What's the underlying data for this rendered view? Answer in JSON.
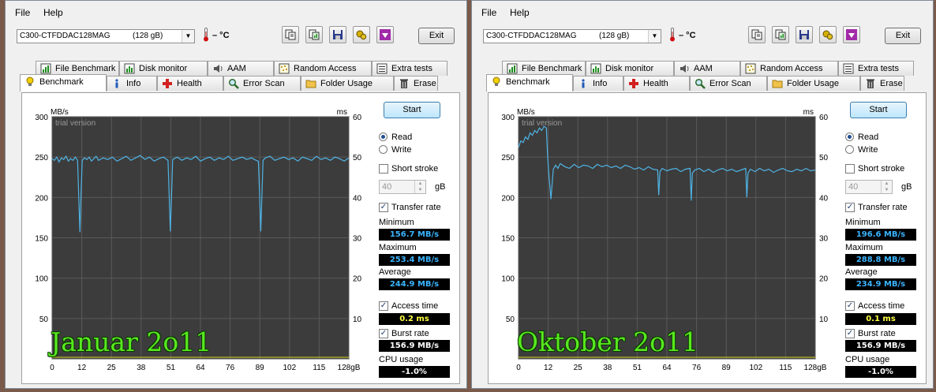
{
  "colors": {
    "accent": "#3399ff",
    "series": "#4fb4e6",
    "plot_bg": "#3c3c3c",
    "grid": "#5a5a5a",
    "overlay_text": "#58e820",
    "value_blue": "#3ab4ff",
    "value_yellow": "#ffff40"
  },
  "windows": [
    {
      "menu": {
        "file": "File",
        "help": "Help"
      },
      "drive": {
        "name": "C300-CTFDDAC128MAG",
        "size": "(128 gB)"
      },
      "temperature": "– °C",
      "toolbar_icons": [
        "copy-text-icon",
        "copy-screenshot-icon",
        "save-icon",
        "options-icon",
        "download-icon"
      ],
      "exit_label": "Exit",
      "tabs_top": [
        "File Benchmark",
        "Disk monitor",
        "AAM",
        "Random Access",
        "Extra tests"
      ],
      "tabs_bottom": [
        "Benchmark",
        "Info",
        "Health",
        "Error Scan",
        "Folder Usage",
        "Erase"
      ],
      "active_tab": "Benchmark",
      "start_label": "Start",
      "mode": {
        "read": "Read",
        "write": "Write",
        "selected": "read"
      },
      "short_stroke": {
        "label": "Short stroke",
        "value": "40",
        "unit": "gB",
        "checked": false
      },
      "transfer_rate": {
        "label": "Transfer rate",
        "checked": true
      },
      "minimum": {
        "label": "Minimum",
        "value": "156.7 MB/s"
      },
      "maximum": {
        "label": "Maximum",
        "value": "253.4 MB/s"
      },
      "average": {
        "label": "Average",
        "value": "244.9 MB/s"
      },
      "access_time": {
        "label": "Access time",
        "value": "0.2 ms",
        "checked": true
      },
      "burst_rate": {
        "label": "Burst rate",
        "value": "156.9 MB/s",
        "checked": true
      },
      "cpu_usage": {
        "label": "CPU usage",
        "value": "-1.0%"
      },
      "overlay_label": "Januar 2o11",
      "chart_data": {
        "type": "line",
        "watermark": "trial version",
        "y_left_label": "MB/s",
        "y_right_label": "ms",
        "y_left_range": [
          0,
          300
        ],
        "y_right_range": [
          0,
          60
        ],
        "y_left_ticks": [
          "300",
          "250",
          "200",
          "150",
          "100",
          "50"
        ],
        "y_right_ticks": [
          "60",
          "50",
          "40",
          "30",
          "20",
          "10"
        ],
        "x_range": [
          0,
          128
        ],
        "x_ticks": [
          "0",
          "12",
          "25",
          "38",
          "51",
          "64",
          "76",
          "89",
          "102",
          "115",
          "128gB"
        ],
        "grid": true,
        "series": [
          {
            "x": [
              0,
              1,
              2,
              3,
              4,
              5,
              6,
              7,
              8,
              9,
              10,
              11,
              11.5,
              12,
              12.5,
              13,
              14,
              15,
              16,
              17,
              18,
              19,
              20,
              22,
              24,
              26,
              28,
              30,
              32,
              34,
              36,
              38,
              40,
              42,
              44,
              46,
              48,
              50,
              50.5,
              51,
              51.5,
              52,
              54,
              56,
              58,
              60,
              62,
              64,
              66,
              68,
              70,
              72,
              74,
              76,
              78,
              80,
              82,
              84,
              86,
              88,
              89,
              89.5,
              90,
              90.5,
              91,
              92,
              94,
              96,
              98,
              100,
              102,
              104,
              106,
              108,
              110,
              112,
              114,
              116,
              118,
              120,
              122,
              124,
              126,
              128
            ],
            "y": [
              248,
              246,
              250,
              244,
              249,
              247,
              251,
              245,
              248,
              246,
              250,
              246,
              200,
              157,
              205,
              246,
              249,
              247,
              250,
              245,
              248,
              251,
              246,
              249,
              247,
              250,
              245,
              248,
              251,
              246,
              249,
              252,
              247,
              250,
              245,
              248,
              250,
              246,
              205,
              158,
              200,
              247,
              250,
              246,
              249,
              247,
              251,
              245,
              248,
              250,
              246,
              249,
              247,
              251,
              246,
              248,
              250,
              247,
              249,
              246,
              245,
              205,
              158,
              200,
              246,
              249,
              251,
              246,
              248,
              250,
              247,
              249,
              245,
              250,
              248,
              246,
              251,
              247,
              249,
              246,
              250,
              248,
              245,
              249
            ]
          }
        ]
      }
    },
    {
      "menu": {
        "file": "File",
        "help": "Help"
      },
      "drive": {
        "name": "C300-CTFDDAC128MAG",
        "size": "(128 gB)"
      },
      "temperature": "– °C",
      "toolbar_icons": [
        "copy-text-icon",
        "copy-screenshot-icon",
        "save-icon",
        "options-icon",
        "download-icon"
      ],
      "exit_label": "Exit",
      "tabs_top": [
        "File Benchmark",
        "Disk monitor",
        "AAM",
        "Random Access",
        "Extra tests"
      ],
      "tabs_bottom": [
        "Benchmark",
        "Info",
        "Health",
        "Error Scan",
        "Folder Usage",
        "Erase"
      ],
      "active_tab": "Benchmark",
      "start_label": "Start",
      "mode": {
        "read": "Read",
        "write": "Write",
        "selected": "read"
      },
      "short_stroke": {
        "label": "Short stroke",
        "value": "40",
        "unit": "gB",
        "checked": false
      },
      "transfer_rate": {
        "label": "Transfer rate",
        "checked": true
      },
      "minimum": {
        "label": "Minimum",
        "value": "196.6 MB/s"
      },
      "maximum": {
        "label": "Maximum",
        "value": "288.8 MB/s"
      },
      "average": {
        "label": "Average",
        "value": "234.9 MB/s"
      },
      "access_time": {
        "label": "Access time",
        "value": "0.1 ms",
        "checked": true
      },
      "burst_rate": {
        "label": "Burst rate",
        "value": "156.9 MB/s",
        "checked": true
      },
      "cpu_usage": {
        "label": "CPU usage",
        "value": "-1.0%"
      },
      "overlay_label": "Oktober 2o11",
      "chart_data": {
        "type": "line",
        "watermark": "trial version",
        "y_left_label": "MB/s",
        "y_right_label": "ms",
        "y_left_range": [
          0,
          300
        ],
        "y_right_range": [
          0,
          60
        ],
        "y_left_ticks": [
          "300",
          "250",
          "200",
          "150",
          "100",
          "50"
        ],
        "y_right_ticks": [
          "60",
          "50",
          "40",
          "30",
          "20",
          "10"
        ],
        "x_range": [
          0,
          128
        ],
        "x_ticks": [
          "0",
          "12",
          "25",
          "38",
          "51",
          "64",
          "76",
          "89",
          "102",
          "115",
          "128gB"
        ],
        "grid": true,
        "series": [
          {
            "x": [
              0,
              1,
              2,
              3,
              4,
              5,
              6,
              7,
              8,
              9,
              10,
              11,
              12,
              12.5,
              13,
              14,
              15,
              16,
              17,
              18,
              20,
              22,
              24,
              26,
              28,
              30,
              32,
              34,
              36,
              38,
              40,
              42,
              44,
              46,
              48,
              50,
              52,
              54,
              56,
              58,
              60,
              60.5,
              61,
              62,
              64,
              66,
              68,
              70,
              72,
              74,
              74.5,
              75,
              76,
              78,
              80,
              82,
              84,
              86,
              88,
              90,
              92,
              94,
              96,
              98,
              98.5,
              99,
              100,
              102,
              104,
              106,
              108,
              110,
              112,
              114,
              116,
              118,
              120,
              122,
              124,
              126,
              128
            ],
            "y": [
              262,
              270,
              268,
              275,
              272,
              280,
              277,
              283,
              280,
              286,
              283,
              288,
              286,
              255,
              232,
              198,
              235,
              240,
              236,
              242,
              238,
              236,
              241,
              237,
              240,
              239,
              236,
              241,
              238,
              240,
              237,
              239,
              236,
              240,
              238,
              235,
              237,
              234,
              238,
              235,
              234,
              203,
              232,
              236,
              233,
              235,
              236,
              232,
              235,
              236,
              196,
              230,
              234,
              236,
              232,
              235,
              231,
              234,
              236,
              233,
              235,
              232,
              234,
              236,
              200,
              230,
              235,
              232,
              236,
              233,
              235,
              231,
              234,
              236,
              233,
              232,
              235,
              233,
              236,
              233,
              234
            ]
          }
        ]
      }
    }
  ]
}
